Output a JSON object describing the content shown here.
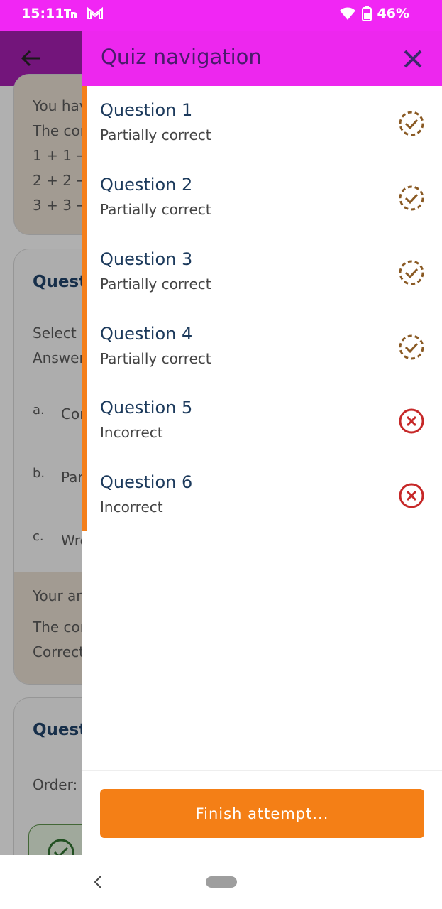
{
  "status": {
    "time": "15:11",
    "battery": "46%"
  },
  "background": {
    "card1_lines": [
      "You hav",
      "The cor",
      "1 + 1 →",
      "2 + 2 →",
      "3 + 3 →"
    ],
    "card2_title": "Questi",
    "card2_lines": [
      "Select o",
      "Answer"
    ],
    "options": [
      {
        "letter": "a.",
        "text": "Cor"
      },
      {
        "letter": "b.",
        "text": "Par"
      },
      {
        "letter": "c.",
        "text": "Wro"
      }
    ],
    "feedback_lines": [
      "Your an",
      "The cor",
      "Correct"
    ],
    "card3_title": "Questi",
    "card3_order": "Order:"
  },
  "drawer": {
    "title": "Quiz navigation",
    "questions": [
      {
        "title": "Question 1",
        "status": "Partially correct",
        "icon": "partial-check-icon"
      },
      {
        "title": "Question 2",
        "status": "Partially correct",
        "icon": "partial-check-icon"
      },
      {
        "title": "Question 3",
        "status": "Partially correct",
        "icon": "partial-check-icon"
      },
      {
        "title": "Question 4",
        "status": "Partially correct",
        "icon": "partial-check-icon"
      },
      {
        "title": "Question 5",
        "status": "Incorrect",
        "icon": "incorrect-x-icon"
      },
      {
        "title": "Question 6",
        "status": "Incorrect",
        "icon": "incorrect-x-icon"
      }
    ],
    "finish_label": "Finish attempt..."
  },
  "colors": {
    "accent": "#f47f16",
    "header": "#ed27ee",
    "partial": "#8a5a24",
    "incorrect": "#c62828"
  }
}
